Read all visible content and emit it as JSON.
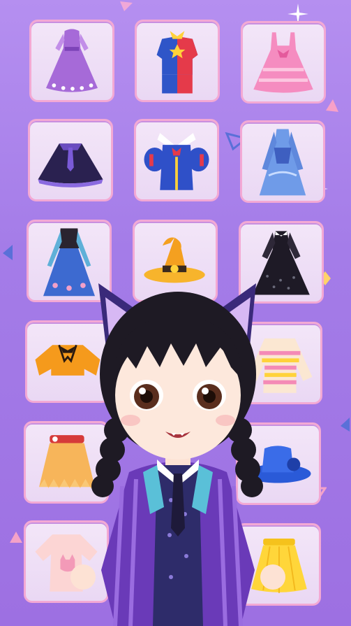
{
  "wardrobe": {
    "items": [
      {
        "icon": "purple-gown-icon"
      },
      {
        "icon": "jester-outfit-icon"
      },
      {
        "icon": "pink-dress-icon"
      },
      {
        "icon": "dark-cape-icon"
      },
      {
        "icon": "snow-white-top-icon"
      },
      {
        "icon": "blue-princess-dress-icon"
      },
      {
        "icon": "anna-dress-icon"
      },
      {
        "icon": "witch-hat-icon"
      },
      {
        "icon": "black-tulle-dress-icon"
      },
      {
        "icon": "orange-crop-top-icon"
      },
      {
        "icon": "striped-sweater-icon"
      },
      {
        "icon": "feather-skirt-icon"
      },
      {
        "icon": "blue-hat-icon"
      },
      {
        "icon": "pink-cat-tee-icon"
      },
      {
        "icon": "yellow-skirt-icon"
      }
    ]
  },
  "character": {
    "icon": "dress-up-girl-avatar"
  },
  "colors": {
    "background": "#a47ce8",
    "tile_border": "#f3a9d4",
    "tile_fill": "#f0e2f7"
  }
}
